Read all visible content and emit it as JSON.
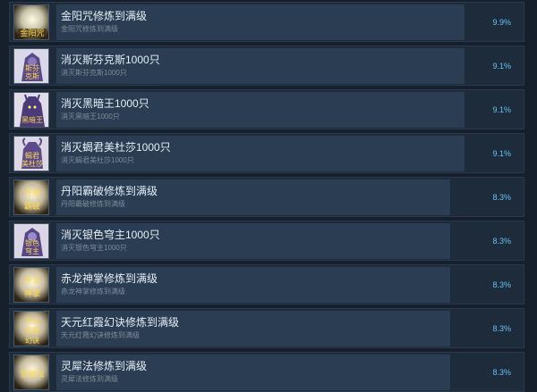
{
  "achievements": [
    {
      "title": "金阳咒修炼到满级",
      "desc": "金阳咒修炼到满级",
      "percent": "9.9%",
      "progress": 0.88,
      "icon": "golden-sun-spell-icon"
    },
    {
      "title": "消灭斯芬克斯1000只",
      "desc": "消灭斯芬克斯1000只",
      "percent": "9.1%",
      "progress": 0.88,
      "icon": "sphinx-monster-icon"
    },
    {
      "title": "消灭黑暗王1000只",
      "desc": "消灭黑暗王1000只",
      "percent": "9.1%",
      "progress": 0.88,
      "icon": "dark-king-monster-icon"
    },
    {
      "title": "消灭蝎君美杜莎1000只",
      "desc": "消灭蝎君美杜莎1000只",
      "percent": "9.1%",
      "progress": 0.88,
      "icon": "medusa-monster-icon"
    },
    {
      "title": "丹阳霸破修炼到满级",
      "desc": "丹阳霸破修炼到满级",
      "percent": "8.3%",
      "progress": 0.85,
      "icon": "danyang-skill-icon"
    },
    {
      "title": "消灭银色穹主1000只",
      "desc": "消灭银色穹主1000只",
      "percent": "8.3%",
      "progress": 0.85,
      "icon": "silver-dome-lord-icon"
    },
    {
      "title": "赤龙神掌修炼到满级",
      "desc": "赤龙神掌修炼到满级",
      "percent": "8.3%",
      "progress": 0.85,
      "icon": "red-dragon-palm-icon"
    },
    {
      "title": "天元红霞幻诀修炼到满级",
      "desc": "天元红霞幻诀修炼到满级",
      "percent": "8.3%",
      "progress": 0.85,
      "icon": "tianyuan-skill-icon"
    },
    {
      "title": "灵犀法修炼到满级",
      "desc": "灵犀法修炼到满级",
      "percent": "8.3%",
      "progress": 0.85,
      "icon": "lingxi-skill-icon"
    }
  ],
  "colors": {
    "background": "#16202d",
    "row": "#1e2b3a",
    "progress": "#2a3d52",
    "percent": "#67c1f5",
    "title": "#e6eef6",
    "desc": "#7d8c9b"
  }
}
